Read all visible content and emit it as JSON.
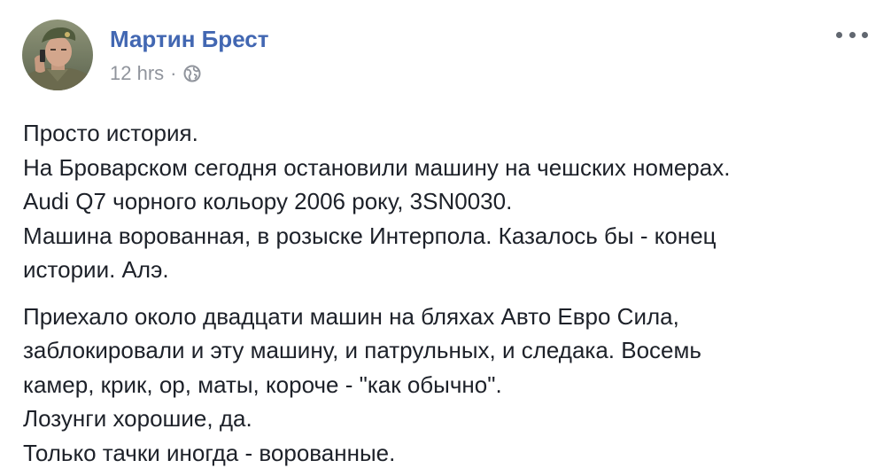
{
  "author": {
    "name": "Мартин Брест"
  },
  "meta": {
    "time": "12 hrs",
    "separator": "·",
    "privacy_icon": "globe-icon"
  },
  "more_icon": "more-options-icon",
  "post": {
    "paragraph1": [
      "Просто история.",
      "На Броварском сегодня остановили машину на чешских номерах.",
      "Audi Q7 чорного кольору 2006 року, 3SN0030.",
      "Машина ворованная, в розыске Интерпола. Казалось бы - конец",
      "истории. Алэ."
    ],
    "paragraph2": [
      "Приехало около двадцати машин на бляхах Авто Евро Сила,",
      "заблокировали и эту машину, и патрульных, и следака. Восемь",
      "камер, крик, ор, маты, короче - \"как обычно\".",
      "Лозунги хорошие, да.",
      "Только тачки иногда - ворованные."
    ]
  },
  "colors": {
    "author": "#4267b2",
    "meta": "#90949c",
    "text": "#1d2129",
    "icon": "#616770"
  }
}
